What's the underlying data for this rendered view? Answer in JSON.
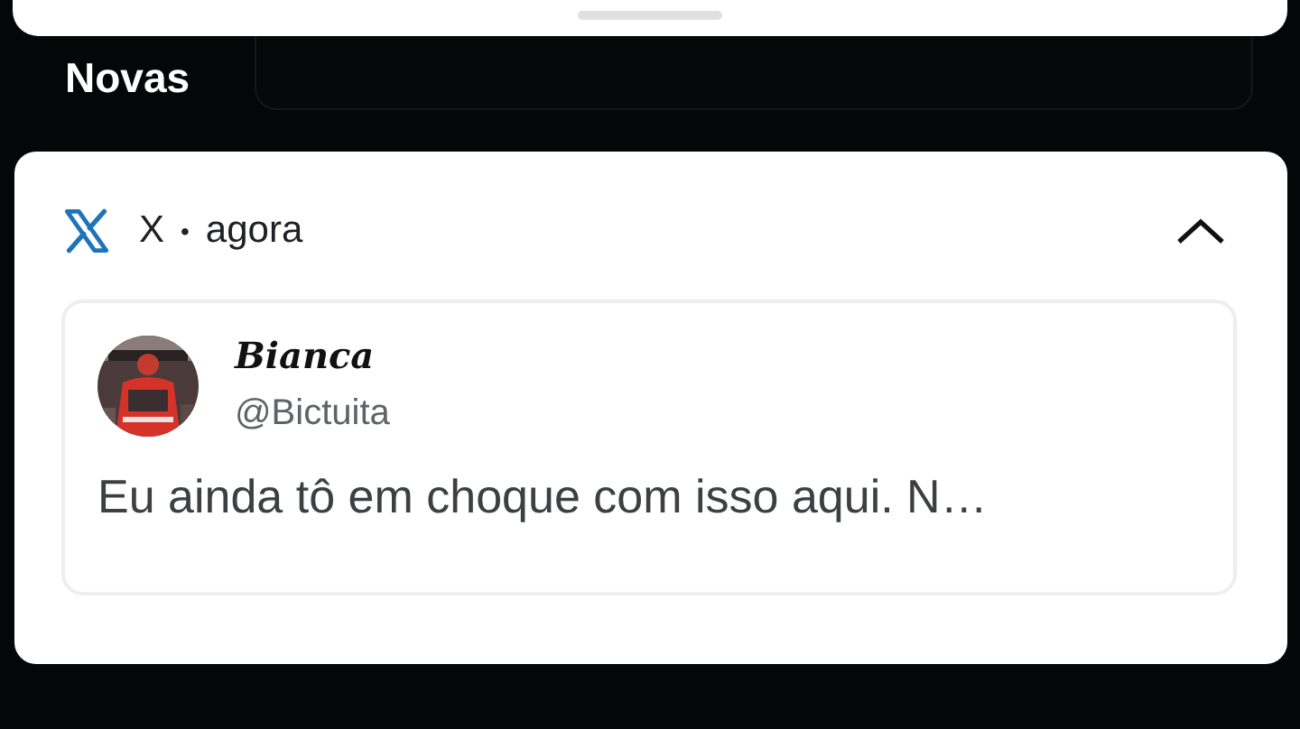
{
  "section_title": "Novas",
  "notification": {
    "app": "X",
    "separator": "•",
    "time": "agora",
    "expanded": true,
    "post": {
      "name": "Bianca",
      "handle": "@Bictuita",
      "text": "Eu ainda tô em choque com isso aqui. N…"
    }
  }
}
